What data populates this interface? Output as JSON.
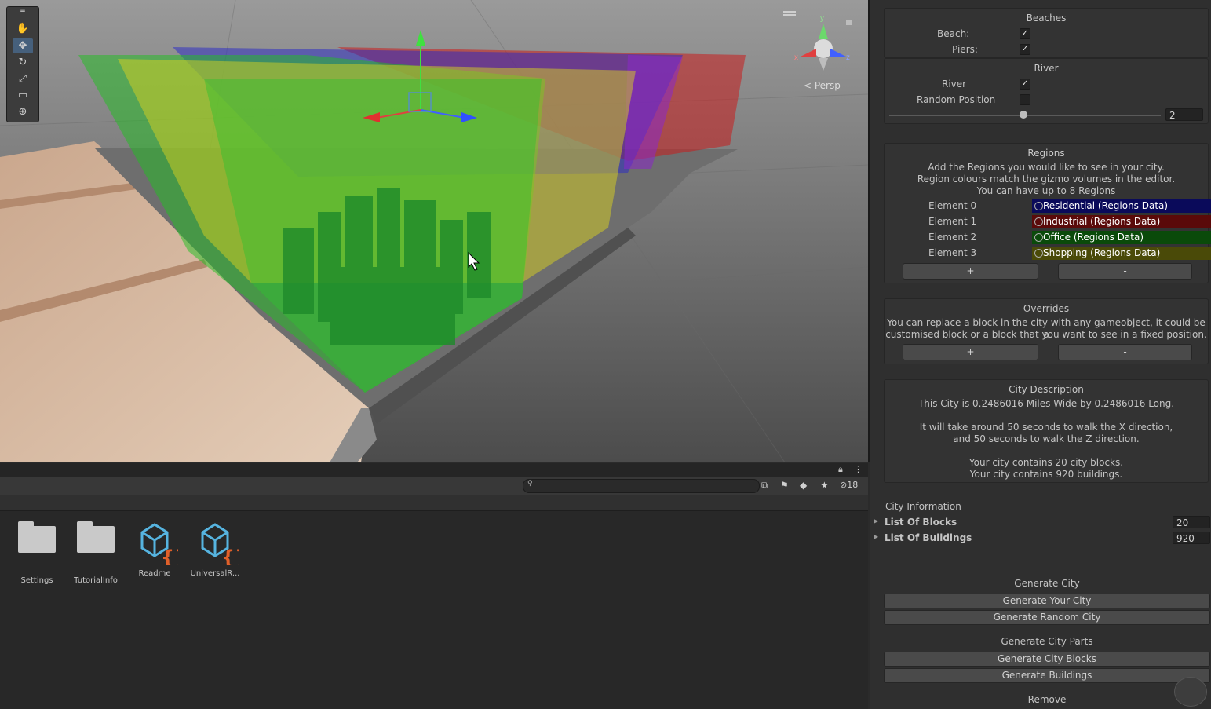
{
  "scene": {
    "persp_label": "< Persp",
    "gizmo_axes": {
      "x": "x",
      "y": "y",
      "z": "z"
    },
    "tools": [
      "hand-tool",
      "move-tool",
      "rotate-tool",
      "scale-tool",
      "rect-tool",
      "transform-tool"
    ],
    "region_colors": {
      "residential": "#2424c8",
      "industrial": "#c82020",
      "office": "#10a810",
      "shopping": "#c8c820"
    }
  },
  "project": {
    "hidden_count": "18",
    "assets": [
      {
        "name": "Settings",
        "kind": "folder"
      },
      {
        "name": "TutorialInfo",
        "kind": "folder"
      },
      {
        "name": "Readme",
        "kind": "script-asset"
      },
      {
        "name": "UniversalR...",
        "kind": "script-asset"
      }
    ]
  },
  "inspector": {
    "beaches": {
      "title": "Beaches",
      "beach_label": "Beach:",
      "beach_checked": true,
      "piers_label": "Piers:",
      "piers_checked": true
    },
    "river": {
      "title": "River",
      "river_label": "River",
      "river_checked": true,
      "random_label": "Random Position",
      "random_checked": false,
      "slider_value": "2"
    },
    "regions": {
      "title": "Regions",
      "desc1": "Add the Regions you would like to see in your city.",
      "desc2": "Region colours match the gizmo volumes in the editor.",
      "desc3": "You can have up to 8 Regions",
      "elements": [
        {
          "label": "Element 0",
          "value": "Residential (Regions Data)",
          "bg": "#0a0a5a",
          "target": "#3a3aff"
        },
        {
          "label": "Element 1",
          "value": "Industrial (Regions Data)",
          "bg": "#5a0a0a",
          "target": "#ff3030"
        },
        {
          "label": "Element 2",
          "value": "Office (Regions Data)",
          "bg": "#0a4a0a",
          "target": "#30e030"
        },
        {
          "label": "Element 3",
          "value": "Shopping (Regions Data)",
          "bg": "#4a4a08",
          "target": "#e0e030"
        }
      ],
      "add": "+",
      "remove": "-"
    },
    "overrides": {
      "title": "Overrides",
      "desc1": "You can replace a block in the city with any gameobject, it could be a",
      "desc2": "customised block or a block that you want to see in a fixed position.",
      "add": "+",
      "remove": "-"
    },
    "description": {
      "title": "City Description",
      "line1": "This City is 0.2486016 Miles Wide by 0.2486016 Long.",
      "line2": "It will take around 50 seconds to walk the X direction,",
      "line3": "and 50 seconds to walk the Z direction.",
      "line4": "Your city contains 20 city blocks.",
      "line5": "Your city contains 920 buildings."
    },
    "info": {
      "title": "City Information",
      "blocks_label": "List Of Blocks",
      "blocks_value": "20",
      "buildings_label": "List Of Buildings",
      "buildings_value": "920"
    },
    "generate": {
      "title": "Generate City",
      "your_city": "Generate Your City",
      "random_city": "Generate Random City",
      "parts_title": "Generate City Parts",
      "blocks": "Generate City Blocks",
      "buildings": "Generate Buildings",
      "remove_title": "Remove"
    }
  }
}
